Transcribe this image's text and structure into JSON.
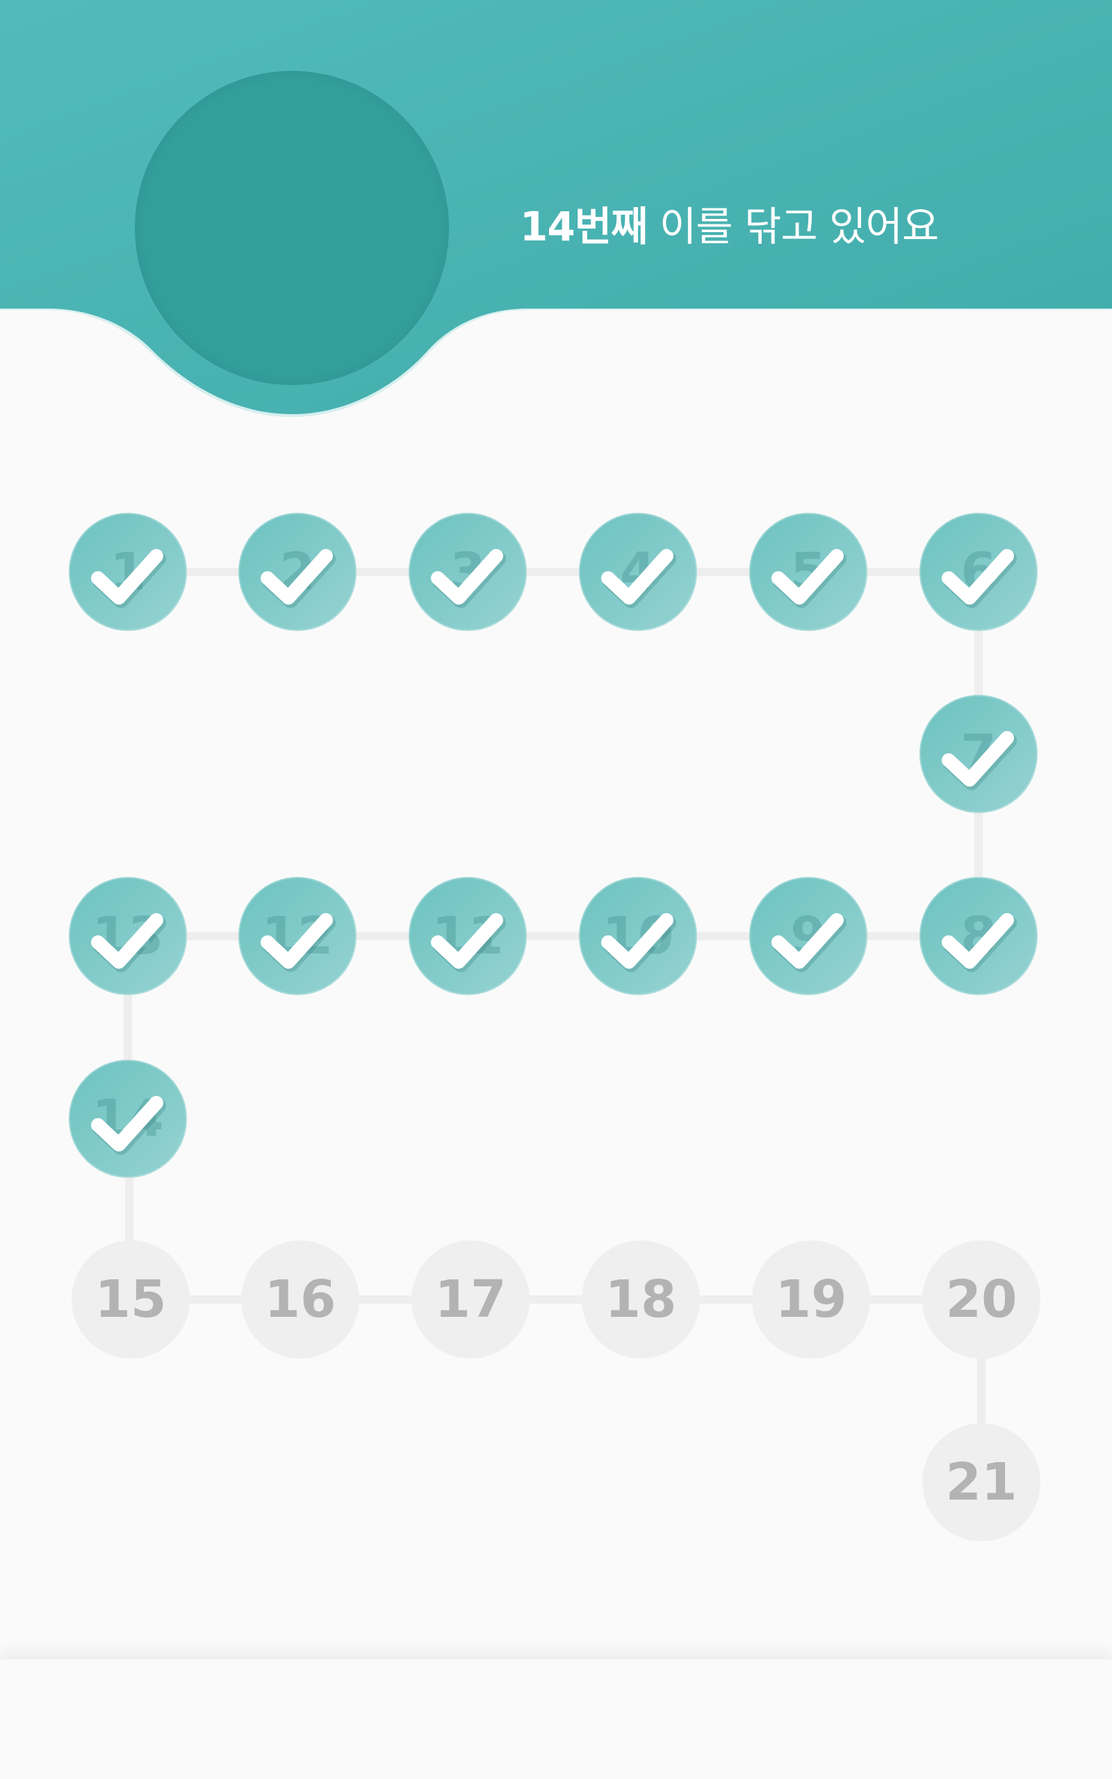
{
  "header": {
    "title_number": "14번째",
    "title_rest": " 이를 닦고 있어요",
    "gradient_start": "#4fb9b9",
    "gradient_end": "#42acac"
  },
  "progress": {
    "current": 14,
    "steps": [
      {
        "label": "1",
        "done": true
      },
      {
        "label": "2",
        "done": true
      },
      {
        "label": "3",
        "done": true
      },
      {
        "label": "4",
        "done": true
      },
      {
        "label": "5",
        "done": true
      },
      {
        "label": "6",
        "done": true
      },
      {
        "label": "7",
        "done": true
      },
      {
        "label": "8",
        "done": true
      },
      {
        "label": "9",
        "done": true
      },
      {
        "label": "10",
        "done": true
      },
      {
        "label": "11",
        "done": true
      },
      {
        "label": "12",
        "done": true
      },
      {
        "label": "13",
        "done": true
      },
      {
        "label": "14",
        "done": true
      },
      {
        "label": "15",
        "done": false
      },
      {
        "label": "16",
        "done": false
      },
      {
        "label": "17",
        "done": false
      },
      {
        "label": "18",
        "done": false
      },
      {
        "label": "19",
        "done": false
      },
      {
        "label": "20",
        "done": false
      },
      {
        "label": "21",
        "done": false
      }
    ],
    "done_color": "#7ccbc9",
    "todo_color": "#efefef",
    "check_icon": "check-icon"
  }
}
